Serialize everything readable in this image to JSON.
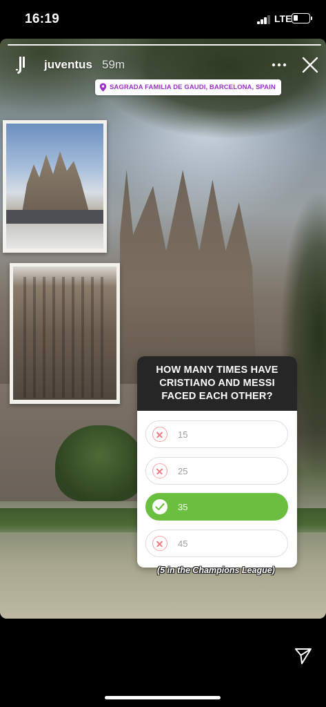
{
  "status_bar": {
    "time": "16:19",
    "network": "LTE",
    "icons": [
      "signal-icon",
      "battery-icon"
    ]
  },
  "story": {
    "username": "juventus",
    "time_ago": "59m",
    "icons": [
      "juventus-logo",
      "more-icon",
      "close-icon",
      "send-icon"
    ],
    "location": {
      "text": "SAGRADA FAMILIA DE GAUDI, BARCELONA, SPAIN",
      "icon": "pin-icon",
      "color": "#9b2cc8"
    }
  },
  "quiz": {
    "question": "HOW MANY TIMES HAVE CRISTIANO AND MESSI FACED EACH OTHER?",
    "options": [
      {
        "label": "15",
        "state": "wrong"
      },
      {
        "label": "25",
        "state": "wrong"
      },
      {
        "label": "35",
        "state": "correct"
      },
      {
        "label": "45",
        "state": "wrong"
      }
    ],
    "colors": {
      "correct": "#6bbf3f",
      "wrong": "#ec7a82",
      "header": "#262626"
    }
  },
  "caption": "(5 in the Champions League)"
}
